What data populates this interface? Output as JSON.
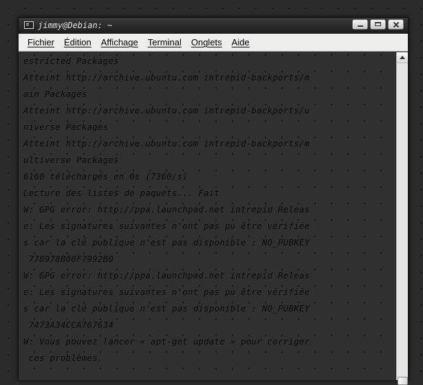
{
  "window": {
    "title": "jimmy@Debian: ~",
    "buttons": {
      "minimize": "minimize",
      "maximize": "maximize",
      "close": "close"
    }
  },
  "menu": [
    {
      "label": "Fichier",
      "key": "fichier"
    },
    {
      "label": "Édition",
      "key": "edition"
    },
    {
      "label": "Affichage",
      "key": "affichage"
    },
    {
      "label": "Terminal",
      "key": "terminal"
    },
    {
      "label": "Onglets",
      "key": "onglets"
    },
    {
      "label": "Aide",
      "key": "aide"
    }
  ],
  "terminal": {
    "lines": [
      "estricted Packages",
      "Atteint http://archive.ubuntu.com intrepid-backports/m",
      "ain Packages",
      "Atteint http://archive.ubuntu.com intrepid-backports/u",
      "niverse Packages",
      "Atteint http://archive.ubuntu.com intrepid-backports/m",
      "ultiverse Packages",
      "6160 téléchargés en 0s (7360/s)",
      "Lecture des listes de paquets... Fait",
      "W: GPG error: http://ppa.launchpad.net intrepid Releas",
      "e: Les signatures suivantes n'ont pas pu être vérifiée",
      "s car la clé publique n'est pas disponible : NO_PUBKEY",
      " 778978B00F7992B0",
      "W: GPG error: http://ppa.launchpad.net intrepid Releas",
      "e: Les signatures suivantes n'ont pas pu être vérifiée",
      "s car la clé publique n'est pas disponible : NO_PUBKEY",
      " 7473A34CCA767634",
      "W: Vous pouvez lancer « apt-get update » pour corriger",
      " ces problèmes."
    ]
  },
  "scrollbar": {
    "position": 1.0
  },
  "icons": {
    "title": "terminal-icon",
    "scroll_up": "arrow-up-icon"
  }
}
